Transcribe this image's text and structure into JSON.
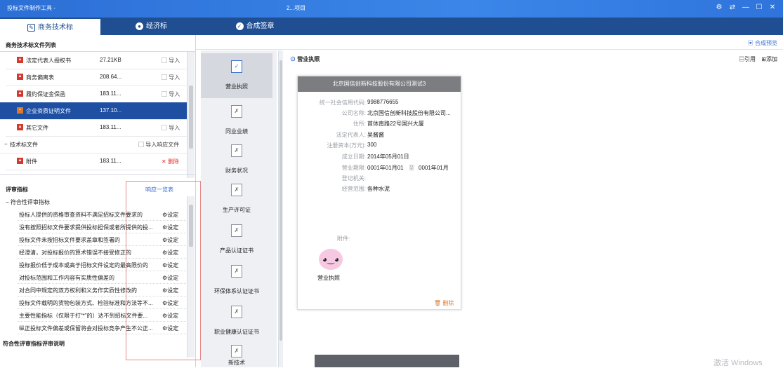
{
  "titlebar": {
    "app_title": "投标文件制作工具 -",
    "project": "2...项目",
    "controls": [
      "⚙",
      "⇄",
      "—",
      "☐",
      "✕"
    ]
  },
  "tabs": [
    {
      "label": "商务技术标",
      "icon": "edit-icon",
      "active": true
    },
    {
      "label": "经济标",
      "icon": "circle-icon",
      "active": false
    },
    {
      "label": "合成签章",
      "icon": "check-circle-icon",
      "active": false
    }
  ],
  "left": {
    "list_title": "商务技术标文件列表",
    "files": [
      {
        "name": "法定代表人授权书",
        "size": "27.21KB",
        "action": "导入"
      },
      {
        "name": "商务偏离表",
        "size": "208.64...",
        "action": "导入"
      },
      {
        "name": "履约保证金保函",
        "size": "183.11...",
        "action": "导入"
      },
      {
        "name": "企业资质证明文件",
        "size": "137.10...",
        "action": "",
        "selected": true
      },
      {
        "name": "其它文件",
        "size": "183.11...",
        "action": "导入"
      }
    ],
    "tech_section": {
      "label": "技术标文件",
      "action": "导入响应文件"
    },
    "tech_files": [
      {
        "name": "附件",
        "size": "183.11...",
        "action": "删除"
      }
    ],
    "eval_title": "评审指标",
    "eval_link": "响应一览表",
    "eval_group": "符合性评审指标",
    "criteria": [
      {
        "text": "投标人提供的资格审查资料不满足招标文件要求的",
        "btn": "设定"
      },
      {
        "text": "没有按照招标文件要求提供投标担保或者所提供的投...",
        "btn": "设定"
      },
      {
        "text": "投标文件未按招标文件要求盖章和签署的",
        "btn": "设定"
      },
      {
        "text": "经澄清，对投标报价的算术错误不接受修正的",
        "btn": "设定"
      },
      {
        "text": "投标报价低于成本或高于招标文件设定的最高限价的",
        "btn": "设定"
      },
      {
        "text": "对投标范围和工作内容有实质性偏差的",
        "btn": "设定"
      },
      {
        "text": "对合同中规定的双方权利和义务作实质性修改的",
        "btn": "设定"
      },
      {
        "text": "投标文件载明的货物包装方式、检验标准和方法等不...",
        "btn": "设定"
      },
      {
        "text": "主要性能指标（仅限于打“*”的）达不到招标文件要...",
        "btn": "设定"
      },
      {
        "text": "纵正投标文件偏差或保留将会对投标竞争产生不公正...",
        "btn": "设定"
      }
    ],
    "footer_title": "符合性评审指标评审说明"
  },
  "toolbar": {
    "preview": "合成预览"
  },
  "categories": [
    {
      "label": "营业执照",
      "active": true
    },
    {
      "label": "同业业绩"
    },
    {
      "label": "财务状况"
    },
    {
      "label": "生产许可证"
    },
    {
      "label": "产品认证证书"
    },
    {
      "label": "环保体系认证证书"
    },
    {
      "label": "职业健康认证证书"
    },
    {
      "label": "新技术"
    }
  ],
  "doc": {
    "section_title": "营业执照",
    "cite": "引用",
    "add": "添加",
    "company_header": "北京国信创新科技股份有限公司测试3",
    "fields": [
      {
        "k": "统一社会信用代码:",
        "v": "9988776655"
      },
      {
        "k": "公司名称:",
        "v": "北京国信创新科技股份有限公司..."
      },
      {
        "k": "住所:",
        "v": "首体南路22号国兴大厦"
      },
      {
        "k": "法定代表人:",
        "v": "吴酱酱"
      },
      {
        "k": "注册资本(万元):",
        "v": "300"
      },
      {
        "k": "成立日期:",
        "v": "2014年05月01日"
      },
      {
        "k": "营业期限:",
        "v": "0001年01月01",
        "v2": "至",
        "v3": "0001年01月"
      },
      {
        "k": "登记机关:",
        "v": ""
      },
      {
        "k": "经营范围:",
        "v": "各种水泥"
      }
    ],
    "attachment_label": "附件:",
    "attachment_name": "营业执照",
    "delete": "删除"
  },
  "watermark": "激活 Windows"
}
